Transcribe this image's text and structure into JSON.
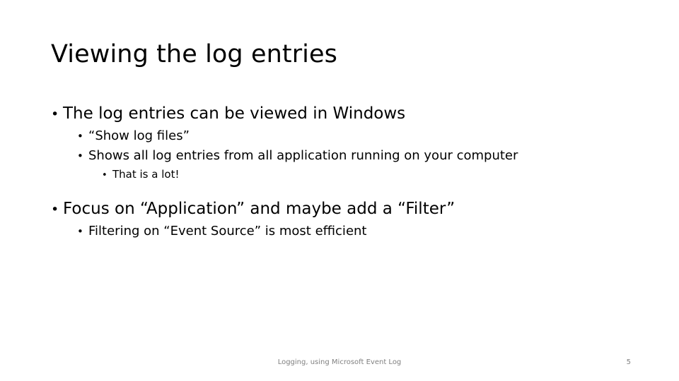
{
  "slide": {
    "title": "Viewing the log entries",
    "bullet_glyph": "•",
    "body": [
      {
        "level": 1,
        "text": "The log entries can be viewed in Windows",
        "gap_before": false
      },
      {
        "level": 2,
        "text": "“Show log files”",
        "gap_before": false
      },
      {
        "level": 2,
        "text": "Shows all log entries from all application running on your computer",
        "gap_before": false
      },
      {
        "level": 3,
        "text": "That is a lot!",
        "gap_before": false
      },
      {
        "level": 1,
        "text": "Focus on “Application” and maybe add a “Filter”",
        "gap_before": true
      },
      {
        "level": 2,
        "text": "Filtering on “Event Source” is most efficient",
        "gap_before": false
      }
    ],
    "footer": {
      "note": "Logging, using Microsoft Event Log",
      "page_number": "5"
    },
    "colors": {
      "background": "#ffffff",
      "text": "#000000",
      "footer_text": "#808080"
    }
  }
}
